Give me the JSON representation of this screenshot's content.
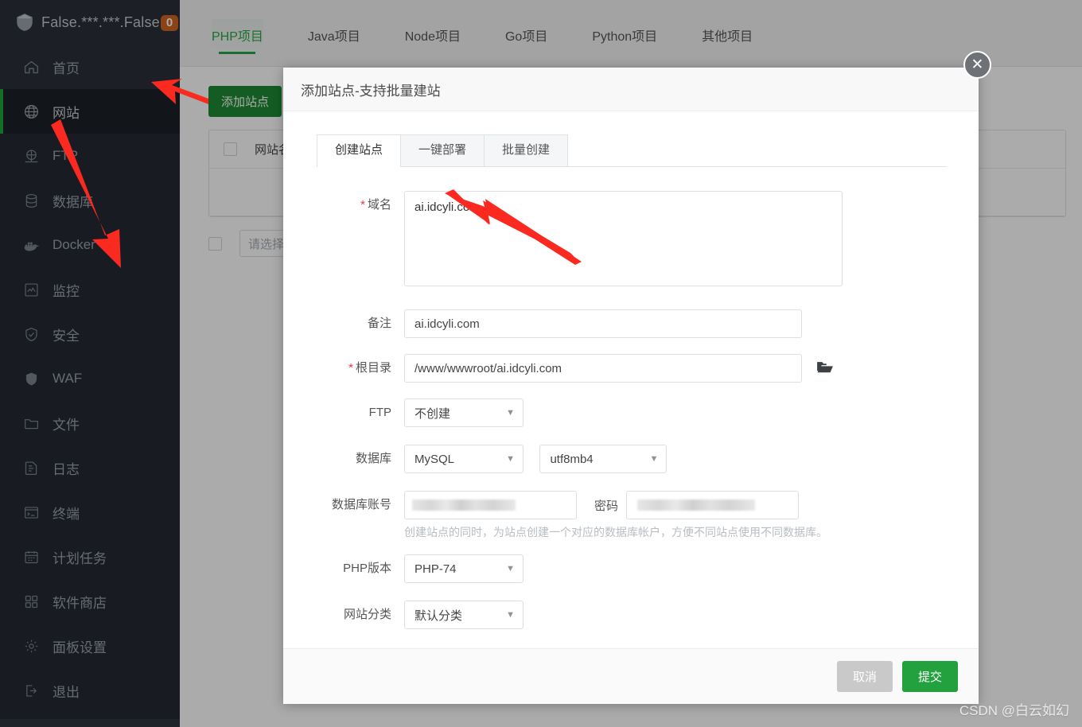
{
  "sidebar": {
    "logo": {
      "text": "False.***.***.False",
      "badge": "0",
      "icon": "shield-icon"
    },
    "items": [
      {
        "label": "首页",
        "icon": "home-icon",
        "state": "hover"
      },
      {
        "label": "网站",
        "icon": "globe-icon",
        "state": "active"
      },
      {
        "label": "FTP",
        "icon": "ftp-icon",
        "state": "normal"
      },
      {
        "label": "数据库",
        "icon": "database-icon",
        "state": "normal"
      },
      {
        "label": "Docker",
        "icon": "docker-icon",
        "state": "normal"
      },
      {
        "label": "监控",
        "icon": "monitor-icon",
        "state": "normal"
      },
      {
        "label": "安全",
        "icon": "shield-check-icon",
        "state": "normal"
      },
      {
        "label": "WAF",
        "icon": "shield-solid-icon",
        "state": "normal"
      },
      {
        "label": "文件",
        "icon": "folder-icon",
        "state": "normal"
      },
      {
        "label": "日志",
        "icon": "log-icon",
        "state": "normal"
      },
      {
        "label": "终端",
        "icon": "terminal-icon",
        "state": "normal"
      },
      {
        "label": "计划任务",
        "icon": "calendar-icon",
        "state": "normal"
      },
      {
        "label": "软件商店",
        "icon": "apps-icon",
        "state": "normal"
      },
      {
        "label": "面板设置",
        "icon": "gear-icon",
        "state": "normal"
      },
      {
        "label": "退出",
        "icon": "logout-icon",
        "state": "normal"
      }
    ]
  },
  "page": {
    "tabs": [
      {
        "label": "PHP项目",
        "active": true
      },
      {
        "label": "Java项目",
        "active": false
      },
      {
        "label": "Node项目",
        "active": false
      },
      {
        "label": "Go项目",
        "active": false
      },
      {
        "label": "Python项目",
        "active": false
      },
      {
        "label": "其他项目",
        "active": false
      }
    ],
    "add_site_button": "添加站点",
    "table_header": "网站名",
    "filter_placeholder": "请选择"
  },
  "modal": {
    "title": "添加站点-支持批量建站",
    "close_icon": "close-icon",
    "tabs": [
      {
        "label": "创建站点",
        "active": true
      },
      {
        "label": "一键部署",
        "active": false
      },
      {
        "label": "批量创建",
        "active": false
      }
    ],
    "fields": {
      "domain": {
        "label": "域名",
        "required": true,
        "value": "ai.idcyli.com"
      },
      "remark": {
        "label": "备注",
        "required": false,
        "value": "ai.idcyli.com"
      },
      "root_dir": {
        "label": "根目录",
        "required": true,
        "value": "/www/wwwroot/ai.idcyli.com",
        "icon": "folder-open-icon"
      },
      "ftp": {
        "label": "FTP",
        "required": false,
        "value": "不创建"
      },
      "database": {
        "label": "数据库",
        "required": false,
        "value": "MySQL",
        "charset": "utf8mb4"
      },
      "db_user": {
        "label": "数据库账号",
        "required": false,
        "value": "",
        "redacted": true
      },
      "db_pass": {
        "label": "密码",
        "required": false,
        "value": "",
        "redacted": true
      },
      "php": {
        "label": "PHP版本",
        "required": false,
        "value": "PHP-74"
      },
      "category": {
        "label": "网站分类",
        "required": false,
        "value": "默认分类"
      }
    },
    "db_hint": "创建站点的同时，为站点创建一个对应的数据库帐户，方便不同站点使用不同数据库。",
    "footer": {
      "cancel": "取消",
      "submit": "提交"
    }
  },
  "annotations": {
    "arrow_color": "#fb2a20",
    "arrows": [
      "arrow-to-website-nav",
      "arrow-to-add-site-button",
      "arrow-to-domain-field"
    ]
  },
  "watermark": "CSDN @白云如幻",
  "colors": {
    "sidebar_bg": "#252b33",
    "accent_green": "#22a13e",
    "badge_orange": "#cf6420",
    "required_red": "#e4393c"
  }
}
